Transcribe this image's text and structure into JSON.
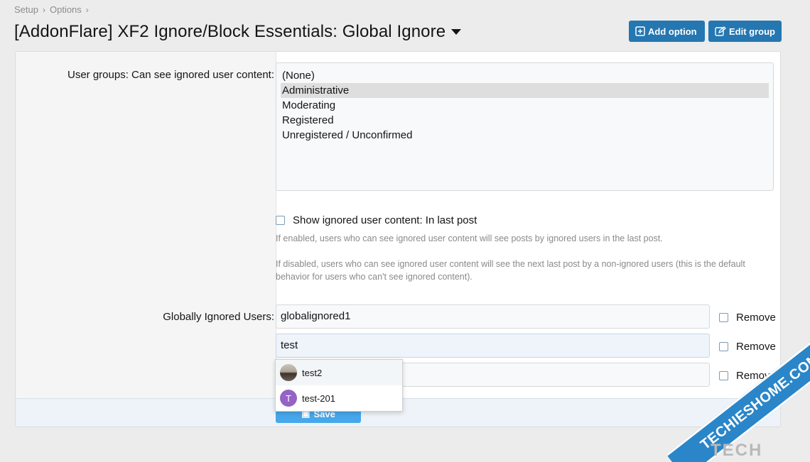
{
  "breadcrumb": [
    "Setup",
    "Options"
  ],
  "page_title": "[AddonFlare] XF2 Ignore/Block Essentials: Global Ignore",
  "header_buttons": {
    "add_option": "Add option",
    "edit_group": "Edit group"
  },
  "user_groups": {
    "label": "User groups: Can see ignored user content:",
    "options": [
      "(None)",
      "Administrative",
      "Moderating",
      "Registered",
      "Unregistered / Unconfirmed"
    ],
    "selected": "Administrative"
  },
  "show_ignored": {
    "label": "Show ignored user content: In last post",
    "checked": false,
    "hint1": "If enabled, users who can see ignored user content will see posts by ignored users in the last post.",
    "hint2": "If disabled, users who can see ignored user content will see the next last post by a non-ignored users (this is the default behavior for users who can't see ignored content)."
  },
  "globally_ignored": {
    "label": "Globally Ignored Users:",
    "rows": [
      {
        "value": "globalignored1",
        "remove_label": "Remove"
      },
      {
        "value": "test",
        "remove_label": "Remove"
      },
      {
        "value": "",
        "remove_label": "Remove"
      }
    ]
  },
  "autocomplete": [
    {
      "name": "test2",
      "avatar": "photo"
    },
    {
      "name": "test-201",
      "avatar": "letter",
      "letter": "T"
    }
  ],
  "save_label": "Save",
  "watermark": {
    "band": "TECHIESHOME.COM",
    "text": "TECH"
  },
  "colors": {
    "primary": "#2577b1",
    "save": "#47a7eb",
    "avatar_letter": "#9563c5"
  }
}
